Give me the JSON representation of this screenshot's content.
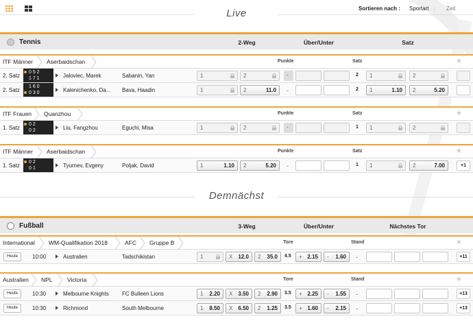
{
  "top": {
    "sort_label": "Sortieren nach :",
    "sort_options": [
      "Sportart",
      "Zeit"
    ],
    "accent": "#f0a23a"
  },
  "sections": {
    "live": "Live",
    "soon": "Demnächst"
  },
  "tennis": {
    "name": "Tennis",
    "columns": [
      "2-Weg",
      "Über/Unter",
      "Satz"
    ],
    "groups": [
      {
        "crumbs": [
          "ITF Männer",
          "Aserbaidschan"
        ],
        "labels": [
          "Punkte",
          "Satz"
        ],
        "rows": [
          {
            "status": "2. Satz",
            "score": [
              "0 5 2",
              "1 7 1"
            ],
            "p1": "Jaloviec, Marek",
            "p2": "Sabanin, Yan",
            "o1k": "1",
            "o2k": "2",
            "pts": "2",
            "s1k": "1",
            "s2k": "2"
          },
          {
            "status": "2. Satz",
            "score": [
              "1 6 0",
              "0 3 0"
            ],
            "p1": "Kalenichenko, Da...",
            "p2": "Bava, Haadin",
            "o1k": "1",
            "o2k": "2",
            "o2v": "11.0",
            "pts": "2",
            "s1k": "1",
            "s1v": "1.10",
            "s2k": "2",
            "s2v": "5.20"
          }
        ]
      },
      {
        "crumbs": [
          "ITF Frauen",
          "Quanzhou"
        ],
        "labels": [
          "Punkte",
          "Satz"
        ],
        "rows": [
          {
            "status": "1. Satz",
            "score": [
              "0 2",
              "0 2"
            ],
            "p1": "Liu, Fangzhou",
            "p2": "Eguchi, Misa",
            "o1k": "1",
            "o2k": "2",
            "pts": "1",
            "s1k": "1",
            "s2k": "2"
          }
        ]
      },
      {
        "crumbs": [
          "ITF Männer",
          "Aserbaidschan"
        ],
        "labels": [
          "Punkte",
          "Satz"
        ],
        "rows": [
          {
            "status": "1. Satz",
            "score": [
              "0 2",
              "0 1"
            ],
            "p1": "Tyurnev, Evgeny",
            "p2": "Poljak, David",
            "o1k": "1",
            "o1v": "1.10",
            "o2k": "2",
            "o2v": "5.20",
            "pts": "1",
            "s1k": "1",
            "s2k": "2",
            "s2v": "7.00",
            "more": "+1"
          }
        ]
      }
    ]
  },
  "football": {
    "name": "Fußball",
    "columns": [
      "3-Weg",
      "Über/Unter",
      "Nächstes Tor"
    ],
    "groups": [
      {
        "crumbs": [
          "International",
          "WM-Qualifikation 2018",
          "AFC",
          "Gruppe B"
        ],
        "labels": [
          "Tore",
          "Stand"
        ],
        "rows": [
          {
            "day": "Heute",
            "time": "10:00",
            "p1": "Australien",
            "p2": "Tadschikistan",
            "o1k": "1",
            "oxk": "X",
            "oxv": "12.0",
            "o2k": "2",
            "o2v": "35.0",
            "line": "4.5",
            "ok": "+",
            "ov": "2.15",
            "uk": "-",
            "uv": "1.60",
            "more": "+11"
          }
        ]
      },
      {
        "crumbs": [
          "Australien",
          "NPL",
          "Victoria"
        ],
        "labels": [
          "Tore",
          "Stand"
        ],
        "rows": [
          {
            "day": "Heute",
            "time": "10:30",
            "p1": "Melbourne Knights",
            "p2": "FC Bulleen Lions",
            "o1k": "1",
            "o1v": "2.20",
            "oxk": "X",
            "oxv": "3.50",
            "o2k": "2",
            "o2v": "2.90",
            "line": "3.5",
            "ok": "+",
            "ov": "2.25",
            "uk": "-",
            "uv": "1.55",
            "more": "+13"
          },
          {
            "day": "Heute",
            "time": "10:30",
            "p1": "Richmond",
            "p2": "South Melbourne",
            "o1k": "1",
            "o1v": "8.50",
            "oxk": "X",
            "oxv": "6.50",
            "o2k": "2",
            "o2v": "1.25",
            "line": "3.5",
            "ok": "+",
            "ov": "1.60",
            "uk": "-",
            "uv": "2.15",
            "more": "+13"
          }
        ]
      }
    ]
  }
}
